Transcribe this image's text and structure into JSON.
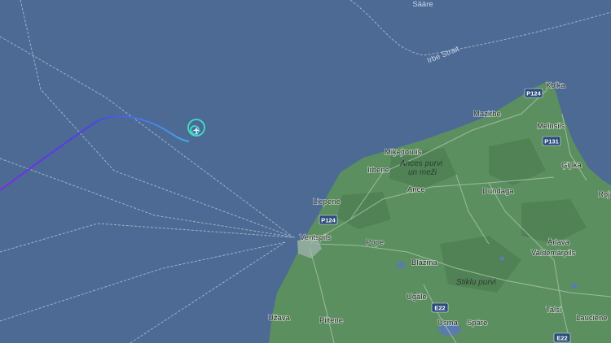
{
  "colors": {
    "sea": "#4c6a94",
    "land": "#5c8f60",
    "land_dark": "#4f8155",
    "route_line": "#c0cad8",
    "track_start": "#7a2be6",
    "track_end": "#46a9e8",
    "track_loop": "#3fe0c9"
  },
  "labels": {
    "saare": "Sääre",
    "irbe_strait": "Irbe Strait",
    "kolka": "Kolka",
    "mazirbe": "Mazirbe",
    "melnsils": "Melnsils",
    "cipka": "Ģipka",
    "mikeltornis": "Miķeļtornis",
    "irbene": "Irbene",
    "ances_purvi_1": "Ances purvi",
    "ances_purvi_2": "un meži",
    "ance": "Ance",
    "dundaga": "Dundaga",
    "roja": "Roja",
    "liepene": "Liepene",
    "ventspils": "Ventspils",
    "pope": "Pope",
    "arlava": "Ārlava",
    "valdemarpils": "Valdemārpils",
    "blazma": "Blāzma",
    "stiklu_purvi": "Stiklu purvi",
    "ugale": "Ugāle",
    "uzava": "Užava",
    "piltene": "Piltene",
    "usma": "Usma",
    "spare": "Spāre",
    "talsi": "Talsi",
    "lauciene": "Lauciene"
  },
  "road_shields": {
    "p124_north": "P124",
    "p131": "P131",
    "p124_ventspils": "P124",
    "e22_west": "E22",
    "e22_east": "E22"
  },
  "icons": {
    "aircraft_marker": "aircraft-icon"
  }
}
